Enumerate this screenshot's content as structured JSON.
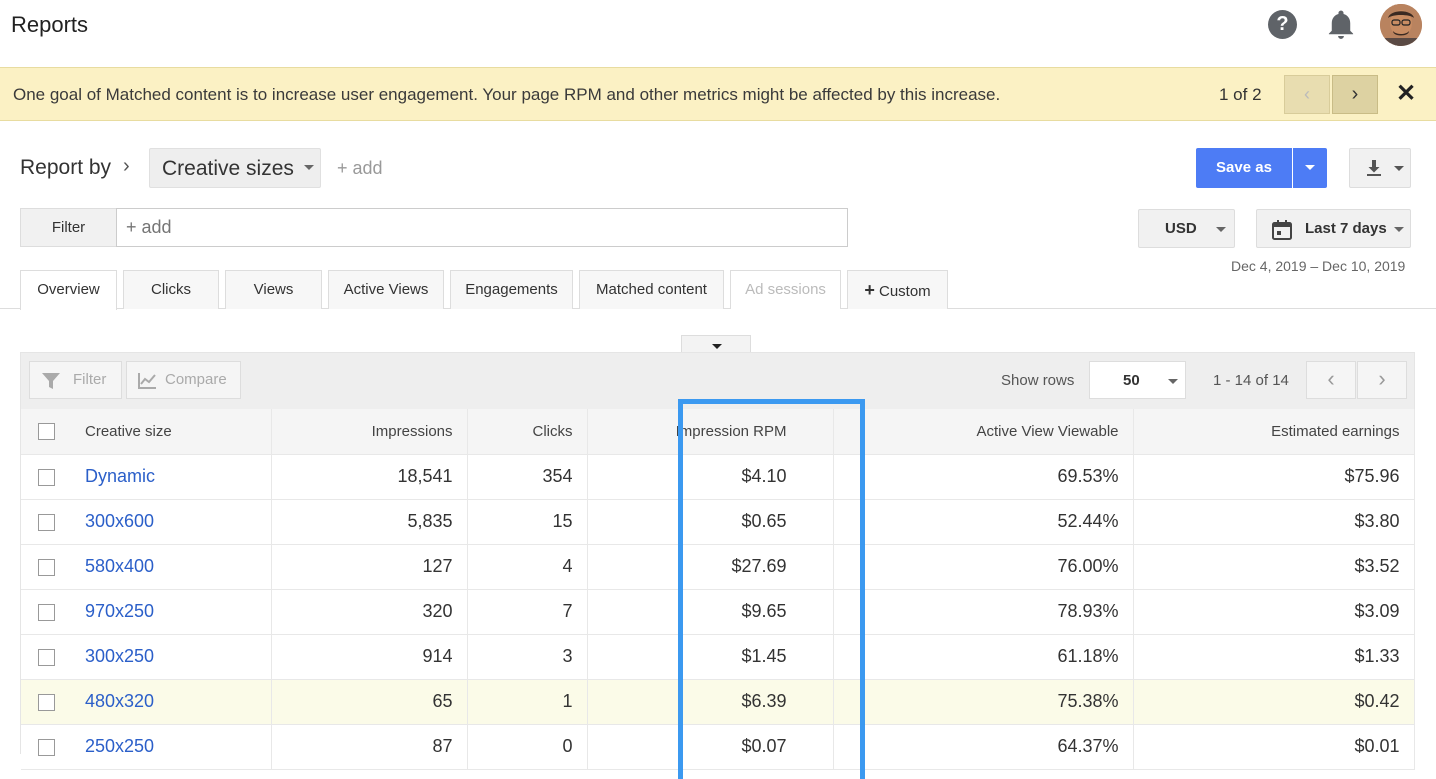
{
  "app": {
    "title": "Reports"
  },
  "banner": {
    "message": "One goal of Matched content is to increase user engagement. Your page RPM and other metrics might be affected by this increase.",
    "counter": "1 of 2",
    "prev": "‹",
    "next": "›",
    "close": "✕"
  },
  "report": {
    "report_by_label": "Report by",
    "chevron": "›",
    "dimension": "Creative sizes",
    "add_dimension": "+ add",
    "save_as": "Save as"
  },
  "filter": {
    "label": "Filter",
    "placeholder": "+ add"
  },
  "currency": "USD",
  "date": {
    "label": "Last 7 days",
    "range": "Dec 4, 2019 – Dec 10, 2019"
  },
  "tabs": [
    {
      "label": "Overview"
    },
    {
      "label": "Clicks"
    },
    {
      "label": "Views"
    },
    {
      "label": "Active Views"
    },
    {
      "label": "Engagements"
    },
    {
      "label": "Matched content"
    },
    {
      "label": "Ad sessions"
    },
    {
      "label": "Custom"
    }
  ],
  "toolbar": {
    "filter": "Filter",
    "compare": "Compare",
    "show_rows_label": "Show rows",
    "rows_value": "50",
    "page_info": "1 - 14 of 14",
    "prev": "‹",
    "next": "›"
  },
  "table": {
    "columns": [
      "Creative size",
      "Impressions",
      "Clicks",
      "Impression RPM",
      "Active View Viewable",
      "Estimated earnings"
    ],
    "rows": [
      [
        "Dynamic",
        "18,541",
        "354",
        "$4.10",
        "69.53%",
        "$75.96"
      ],
      [
        "300x600",
        "5,835",
        "15",
        "$0.65",
        "52.44%",
        "$3.80"
      ],
      [
        "580x400",
        "127",
        "4",
        "$27.69",
        "76.00%",
        "$3.52"
      ],
      [
        "970x250",
        "320",
        "7",
        "$9.65",
        "78.93%",
        "$3.09"
      ],
      [
        "300x250",
        "914",
        "3",
        "$1.45",
        "61.18%",
        "$1.33"
      ],
      [
        "480x320",
        "65",
        "1",
        "$6.39",
        "75.38%",
        "$0.42"
      ],
      [
        "250x250",
        "87",
        "0",
        "$0.07",
        "64.37%",
        "$0.01"
      ]
    ]
  },
  "colors": {
    "accent": "#4d7cf5",
    "banner": "#fbf1c4",
    "link": "#2b5fc9",
    "highlight_box": "#3b99f0"
  }
}
